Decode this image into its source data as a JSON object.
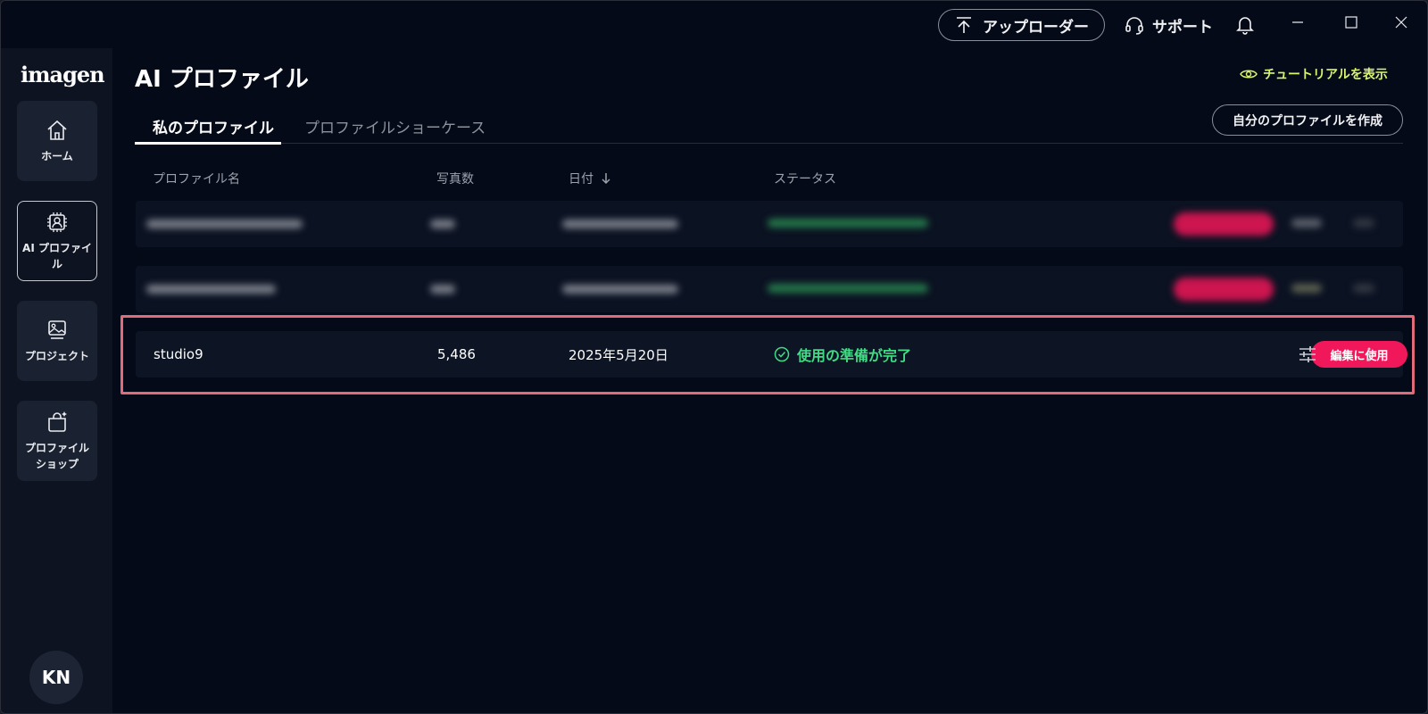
{
  "titlebar": {
    "uploader_label": "アップローダー",
    "support_label": "サポート"
  },
  "sidebar": {
    "logo": "imagen",
    "items": [
      {
        "label": "ホーム",
        "icon": "home-icon"
      },
      {
        "label": "AI プロファイル",
        "icon": "ai-profile-icon"
      },
      {
        "label": "プロジェクト",
        "icon": "project-icon"
      },
      {
        "label": "プロファイルショップ",
        "icon": "shop-icon"
      }
    ],
    "avatar_initials": "KN"
  },
  "main": {
    "title": "AI プロファイル",
    "tutorial_label": "チュートリアルを表示",
    "create_label": "自分のプロファイルを作成",
    "tabs": [
      {
        "label": "私のプロファイル",
        "active": true
      },
      {
        "label": "プロファイルショーケース",
        "active": false
      }
    ],
    "columns": {
      "name": "プロファイル名",
      "photos": "写真数",
      "date": "日付",
      "status": "ステータス"
    },
    "rows": [
      {
        "name": "studio9",
        "photos": "5,486",
        "date": "2025年5月20日",
        "status": "使用の準備が完了",
        "use_label": "編集に使用"
      }
    ]
  },
  "colors": {
    "accent_pink": "#f0175a",
    "status_green": "#3fdc85",
    "tutorial_yellow": "#d9f56b",
    "highlight_border": "#e06b7a"
  }
}
